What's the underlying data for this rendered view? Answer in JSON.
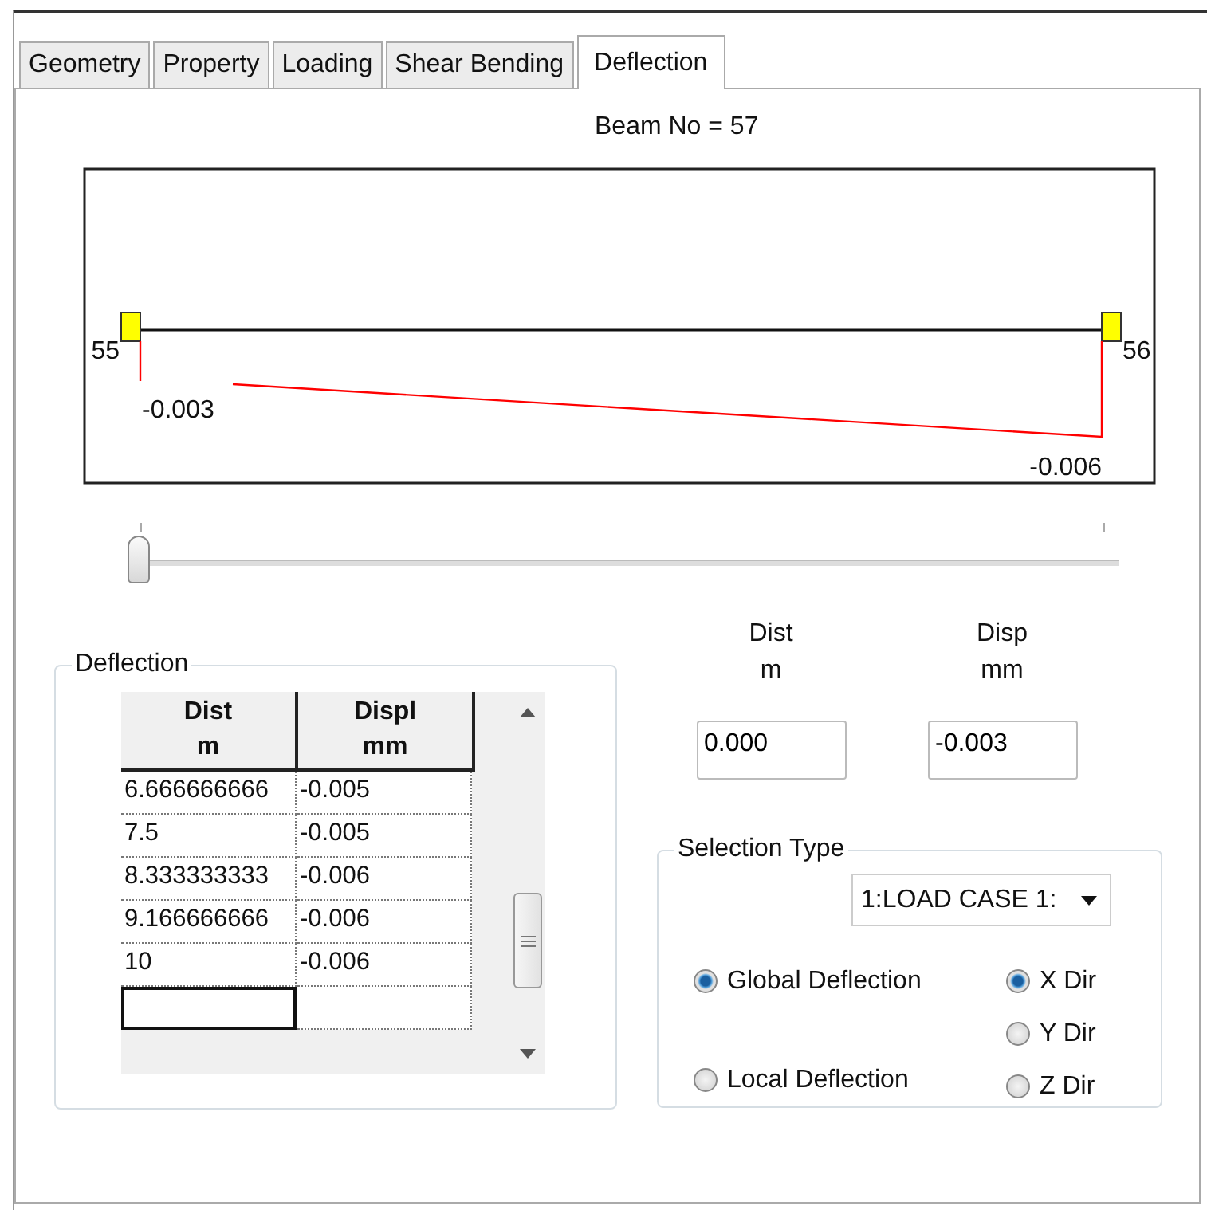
{
  "tabs": [
    {
      "label": "Geometry",
      "selected": false
    },
    {
      "label": "Property",
      "selected": false
    },
    {
      "label": "Loading",
      "selected": false
    },
    {
      "label": "Shear Bending",
      "selected": false
    },
    {
      "label": "Deflection",
      "selected": true
    }
  ],
  "beam_label": "Beam No = 57",
  "diagram": {
    "start_node": "55",
    "end_node": "56",
    "start_value": "-0.003",
    "end_value": "-0.006"
  },
  "position_slider": {
    "level": 0
  },
  "deflection_group": {
    "title": "Deflection",
    "table": {
      "columns": [
        {
          "title": "Dist",
          "unit": "m"
        },
        {
          "title": "Displ",
          "unit": "mm"
        }
      ],
      "rows": [
        [
          "6.666666666",
          "-0.005"
        ],
        [
          "7.5",
          "-0.005"
        ],
        [
          "8.333333333",
          "-0.006"
        ],
        [
          "9.166666666",
          "-0.006"
        ],
        [
          "10",
          "-0.006"
        ]
      ],
      "new_row_focused": true
    }
  },
  "readout": [
    {
      "title": "Dist",
      "unit": "m",
      "value": "0.000"
    },
    {
      "title": "Disp",
      "unit": "mm",
      "value": "-0.003"
    }
  ],
  "selection_type": {
    "title": "Selection Type",
    "load_case": "1:LOAD CASE 1:",
    "deflection_options": [
      {
        "label": "Global Deflection",
        "selected": true
      },
      {
        "label": "Local Deflection",
        "selected": false
      }
    ],
    "direction_options": [
      {
        "label": "X Dir",
        "selected": true
      },
      {
        "label": "Y Dir",
        "selected": false
      },
      {
        "label": "Z Dir",
        "selected": false
      }
    ]
  }
}
